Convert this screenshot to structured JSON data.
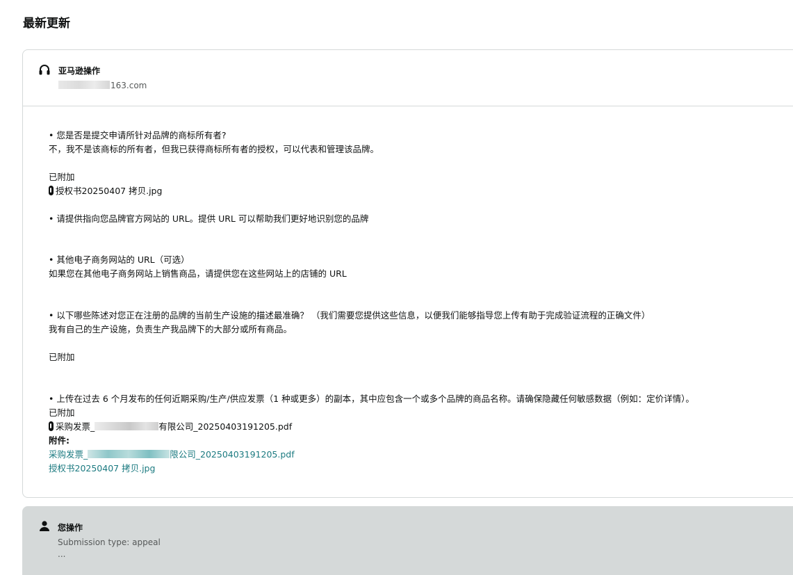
{
  "page": {
    "title": "最新更新"
  },
  "amazon_card": {
    "sender_name": "亚马逊操作",
    "sender_email_suffix": "163.com",
    "q1": "• 您是否是提交申请所针对品牌的商标所有者?",
    "a1": "不，我不是该商标的所有者，但我已获得商标所有者的授权，可以代表和管理该品牌。",
    "attached_label_1": "已附加",
    "attachment_1": "授权书20250407 拷贝.jpg",
    "q2": "• 请提供指向您品牌官方网站的 URL。提供 URL 可以帮助我们更好地识别您的品牌",
    "q3": "• 其他电子商务网站的 URL（可选）",
    "a3": "如果您在其他电子商务网站上销售商品，请提供您在这些网站上的店铺的 URL",
    "q4": "• 以下哪些陈述对您正在注册的品牌的当前生产设施的描述最准确？ （我们需要您提供这些信息，以便我们能够指导您上传有助于完成验证流程的正确文件）",
    "a4": "我有自己的生产设施，负责生产我品牌下的大部分或所有商品。",
    "attached_label_2": "已附加",
    "q5": "• 上传在过去 6 个月发布的任何近期采购/生产/供应发票（1 种或更多）的副本，其中应包含一个或多个品牌的商品名称。请确保隐藏任何敏感数据（例如：定价详情）。",
    "attached_label_3": "已附加",
    "attachment_2_prefix": "采购发票_",
    "attachment_2_suffix": "有限公司_20250403191205.pdf",
    "attachments_heading": "附件:",
    "link_1_prefix": "采购发票_",
    "link_1_suffix": "限公司_20250403191205.pdf",
    "link_2": "授权书20250407 拷贝.jpg"
  },
  "user_card": {
    "sender_name": "您操作",
    "submission_type": "Submission type: appeal",
    "more": "..."
  },
  "icons": {
    "amazon_sender": "headset-icon",
    "user_sender": "person-icon",
    "attachment": "paperclip-icon"
  },
  "colors": {
    "link": "#1b7a80",
    "muted": "#565959",
    "border": "#d5d9d9",
    "user_card_bg": "#d5d9d9"
  }
}
